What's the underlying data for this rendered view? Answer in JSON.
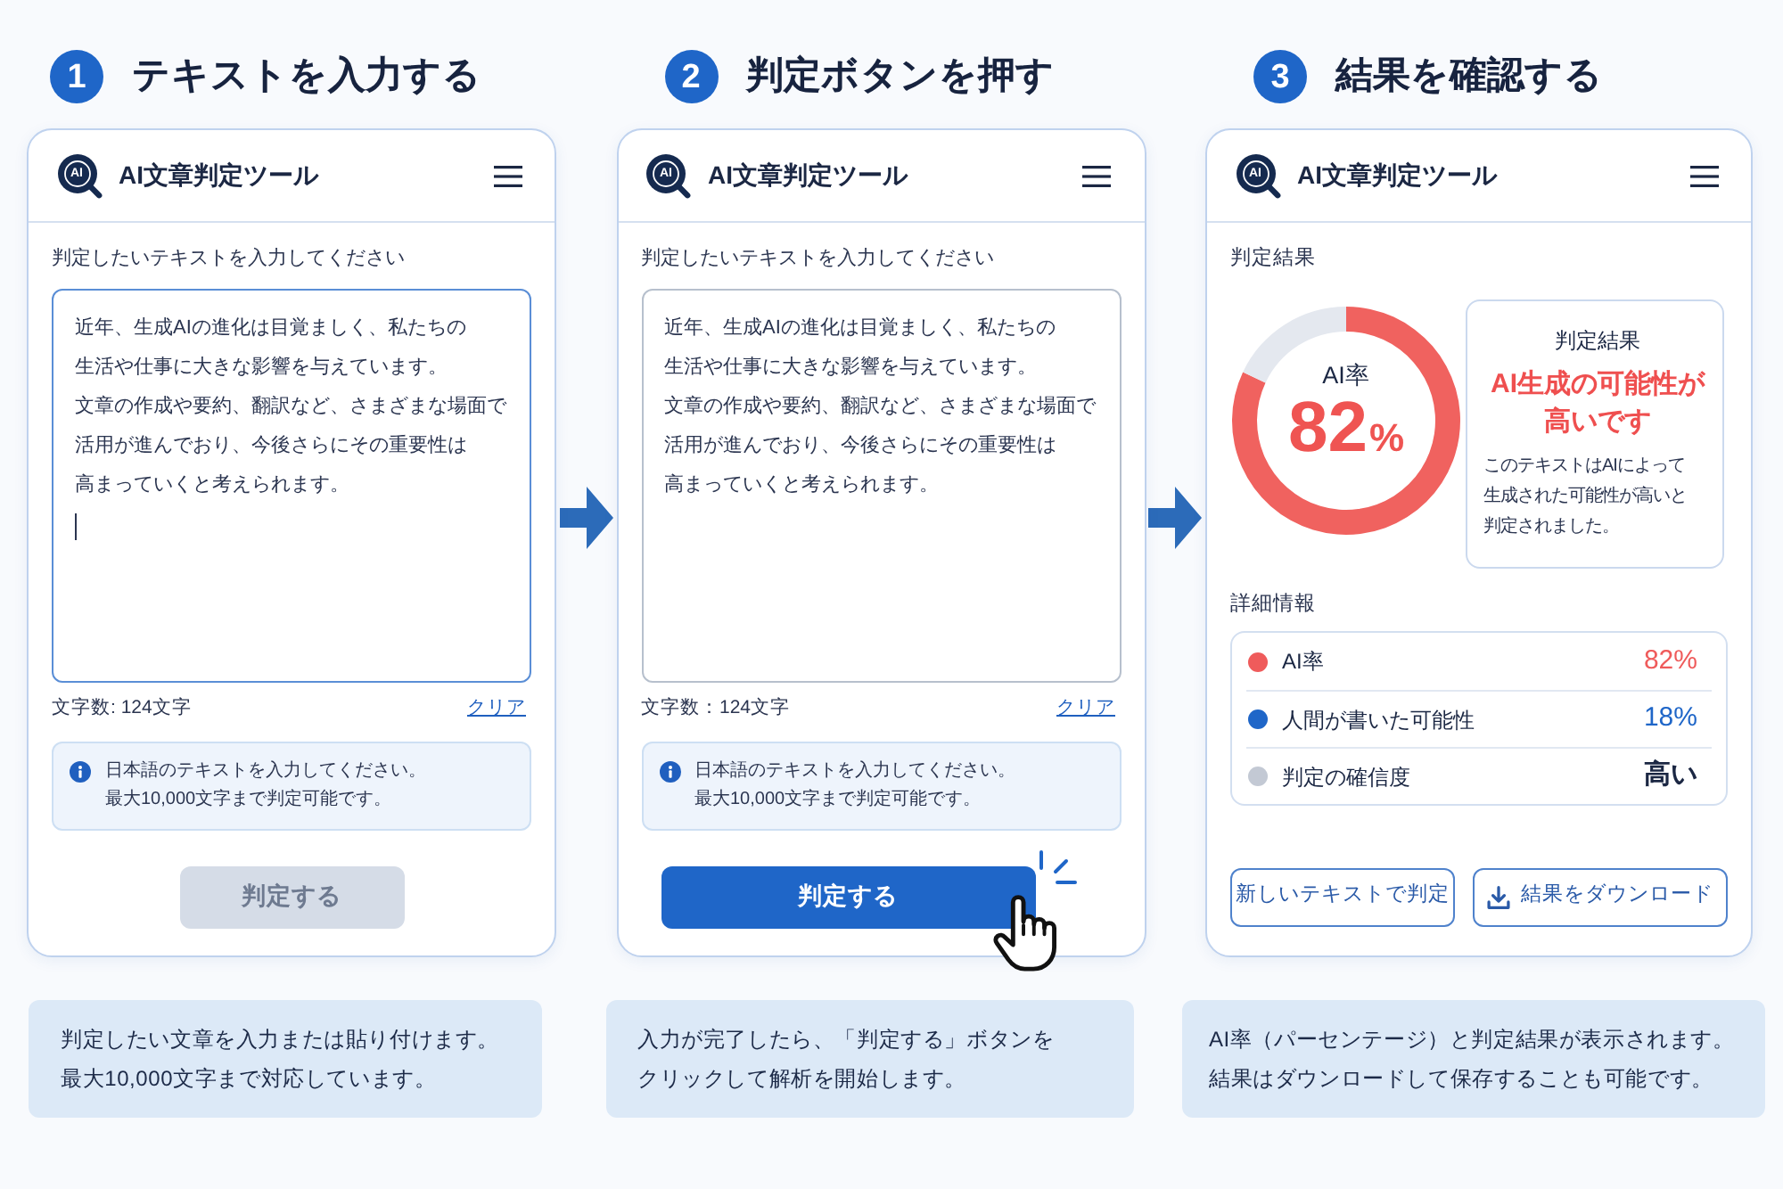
{
  "steps": [
    {
      "number": "1",
      "title": "テキストを入力する",
      "kind": "input",
      "app": {
        "logo_text": "AI",
        "title": "AI文章判定ツール",
        "prompt": "判定したいテキストを入力してください",
        "text_field": {
          "lines": [
            "近年、生成AIの進化は目覚ましく、私たちの",
            "生活や仕事に大きな影響を与えています。",
            "文章の作成や要約、翻訳など、さまざまな場面で",
            "活用が進んでおり、今後さらにその重要性は",
            "高まっていくと考えられます。"
          ],
          "focused": true
        },
        "char_count": "文字数: 124文字",
        "clear_link": "クリア",
        "notice": "日本語のテキストを入力してください。最大10,000文字まで判定可能です。",
        "submit_button": {
          "label": "判定する",
          "disabled": true,
          "pressed": false
        }
      },
      "caption": "判定したい文章を入力または貼り付けます。最大10,000文字まで対応しています。"
    },
    {
      "number": "2",
      "title": "判定ボタンを押す",
      "kind": "input",
      "app": {
        "logo_text": "AI",
        "title": "AI文章判定ツール",
        "prompt": "判定したいテキストを入力してください",
        "text_field": {
          "lines": [
            "近年、生成AIの進化は目覚ましく、私たちの",
            "生活や仕事に大きな影響を与えています。",
            "文章の作成や要約、翻訳など、さまざまな場面で",
            "活用が進んでおり、今後さらにその重要性は",
            "高まっていくと考えられます。"
          ],
          "focused": false
        },
        "char_count": "文字数：124文字",
        "clear_link": "クリア",
        "notice": "日本語のテキストを入力してください。最大10,000文字まで判定可能です。",
        "submit_button": {
          "label": "判定する",
          "disabled": false,
          "pressed": true
        }
      },
      "caption": "入力が完了したら、「判定する」ボタンをクリックして解析を開始します。"
    },
    {
      "number": "3",
      "title": "結果を確認する",
      "kind": "result",
      "app": {
        "logo_text": "AI",
        "title": "AI文章判定ツール",
        "section_label": "判定結果",
        "gauge": {
          "label": "AI率",
          "value": "82",
          "unit": "%",
          "chart_data": {
            "type": "donut",
            "values": [
              82,
              18
            ]
          }
        },
        "summary": {
          "heading": "判定結果",
          "verdict": "AI生成の可能性が高いです",
          "explanation": "このテキストはAIによって生成された可能性が高いと判定されました。"
        },
        "details_label": "詳細情報",
        "details": [
          {
            "label": "AI率",
            "value": "82%",
            "color": "#ef5b5b",
            "kind": "accent"
          },
          {
            "label": "人間が書いた可能性",
            "value": "18%",
            "color": "#1f66c8",
            "kind": "accent"
          },
          {
            "label": "判定の確信度",
            "value": "高い",
            "color": "#c3c9d4",
            "kind": "plain"
          }
        ],
        "buttons": [
          {
            "label": "新しいテキストで判定",
            "with_icon": false
          },
          {
            "label": "結果をダウンロード",
            "with_icon": true
          }
        ]
      },
      "caption": "AI率（パーセンテージ）と判定結果が表示されます。結果はダウンロードして保存することも可能です。"
    }
  ]
}
